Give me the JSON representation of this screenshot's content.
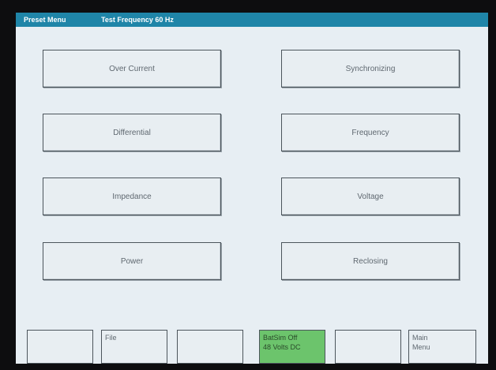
{
  "header": {
    "menu_name": "Preset Menu",
    "test_frequency": "Test Frequency 60 Hz"
  },
  "preset_buttons": {
    "over_current": "Over Current",
    "differential": "Differential",
    "impedance": "Impedance",
    "power": "Power",
    "synchronizing": "Synchronizing",
    "frequency": "Frequency",
    "voltage": "Voltage",
    "reclosing": "Reclosing"
  },
  "softkeys": {
    "file": "File",
    "batsim_line1": "BatSim Off",
    "batsim_line2": "48 Volts DC",
    "main_menu_line1": "Main",
    "main_menu_line2": "Menu"
  },
  "colors": {
    "title_bar": "#1f85a8",
    "screen_background": "#e7eef3",
    "batsim_key": "#6cc46c",
    "bezel": "#0d0d0f"
  }
}
